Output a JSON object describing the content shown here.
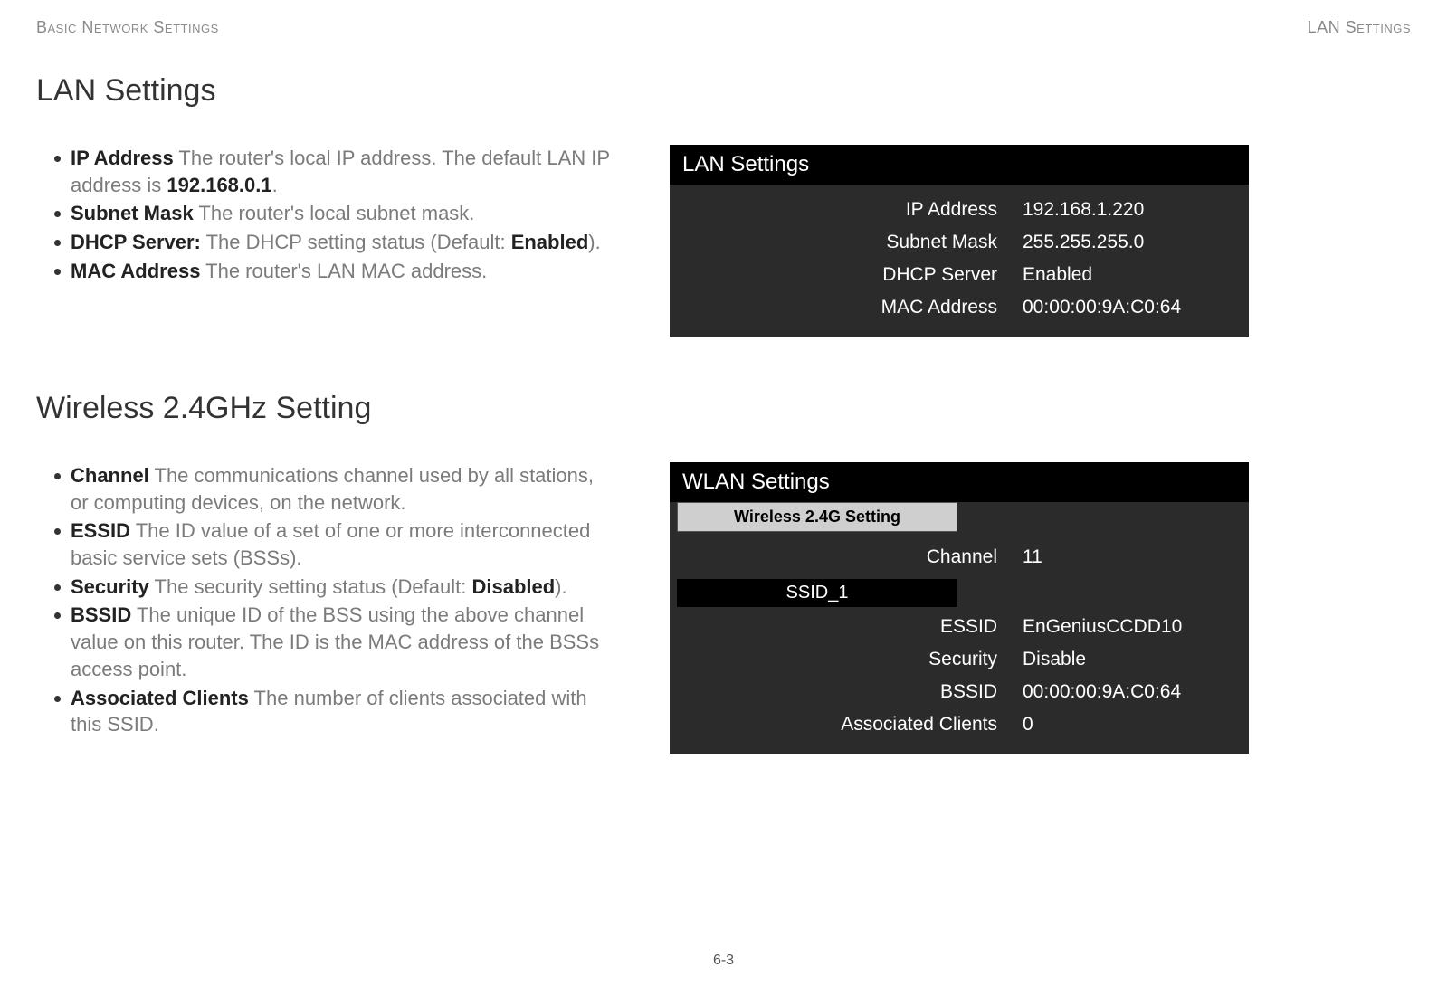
{
  "header": {
    "left": "Basic Network Settings",
    "right": "LAN Settings"
  },
  "lan": {
    "title": "LAN Settings",
    "bullets": {
      "ip_term": "IP Address",
      "ip_desc_pre": "  The router's local IP address. The default LAN IP address is ",
      "ip_default": "192.168.0.1",
      "ip_desc_post": ".",
      "subnet_term": "Subnet Mask",
      "subnet_desc": "  The router's local subnet mask.",
      "dhcp_term": "DHCP Server:",
      "dhcp_desc_pre": " The DHCP setting status (Default: ",
      "dhcp_default": "Enabled",
      "dhcp_desc_post": ").",
      "mac_term": "MAC Address",
      "mac_desc": "  The router's LAN MAC address."
    },
    "panel": {
      "title": "LAN Settings",
      "rows": [
        {
          "label": "IP Address",
          "value": "192.168.1.220"
        },
        {
          "label": "Subnet Mask",
          "value": "255.255.255.0"
        },
        {
          "label": "DHCP Server",
          "value": "Enabled"
        },
        {
          "label": "MAC Address",
          "value": "00:00:00:9A:C0:64"
        }
      ]
    }
  },
  "wlan": {
    "title": "Wireless 2.4GHz Setting",
    "bullets": {
      "channel_term": "Channel",
      "channel_desc": "  The communications channel used by all stations, or computing devices, on the network.",
      "essid_term": "ESSID",
      "essid_desc": "  The ID value of a set of one or more interconnected basic service sets (BSSs).",
      "security_term": "Security",
      "security_desc_pre": "  The security setting status (Default: ",
      "security_default": "Disabled",
      "security_desc_post": ").",
      "bssid_term": "BSSID",
      "bssid_desc": "  The unique ID of the BSS using the above channel value on this router. The ID is the MAC address of the BSSs access point.",
      "clients_term": "Associated Clients",
      "clients_desc": "  The number of clients associated with this SSID."
    },
    "panel": {
      "title": "WLAN Settings",
      "tab": "Wireless 2.4G Setting",
      "channel_label": "Channel",
      "channel_value": "11",
      "ssid_header": "SSID_1",
      "rows": [
        {
          "label": "ESSID",
          "value": "EnGeniusCCDD10"
        },
        {
          "label": "Security",
          "value": "Disable"
        },
        {
          "label": "BSSID",
          "value": "00:00:00:9A:C0:64"
        },
        {
          "label": "Associated Clients",
          "value": "0"
        }
      ]
    }
  },
  "page_number": "6-3"
}
